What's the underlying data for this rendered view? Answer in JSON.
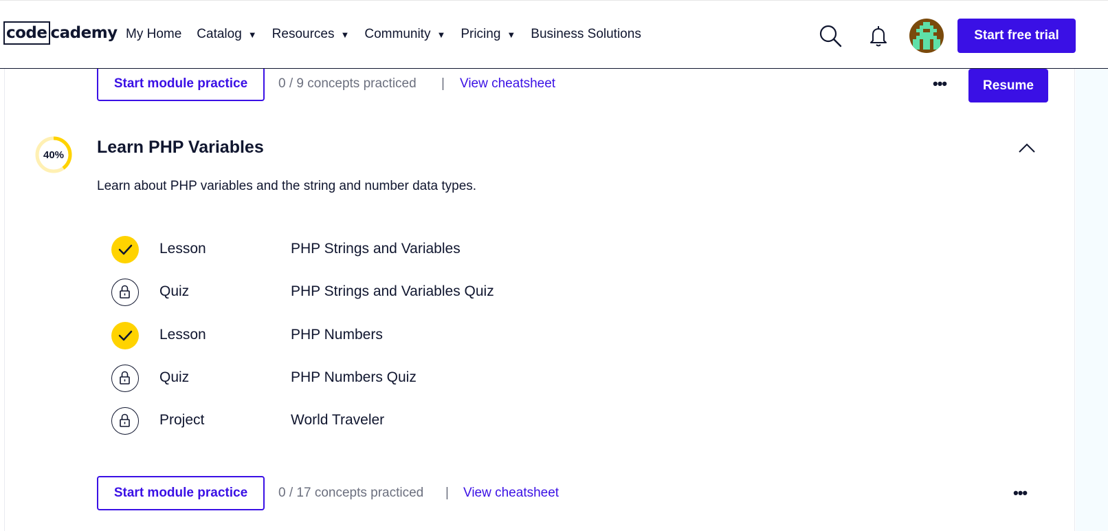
{
  "header": {
    "logo_box": "code",
    "logo_rest": "cademy",
    "nav": [
      {
        "label": "My Home",
        "caret": false
      },
      {
        "label": "Catalog",
        "caret": true
      },
      {
        "label": "Resources",
        "caret": true
      },
      {
        "label": "Community",
        "caret": true
      },
      {
        "label": "Pricing",
        "caret": true
      },
      {
        "label": "Business Solutions",
        "caret": false
      }
    ],
    "caret_glyph": "▼",
    "trial_label": "Start free trial"
  },
  "prev_module": {
    "practice_label": "Start module practice",
    "concepts": "0 / 9 concepts practiced",
    "separator": "|",
    "cheatsheet_label": "View cheatsheet",
    "more_label": "•••",
    "resume_label": "Resume"
  },
  "module": {
    "progress_label": "40%",
    "progress_value": 0.4,
    "title": "Learn PHP Variables",
    "description": "Learn about PHP variables and the string and number data types.",
    "items": [
      {
        "kind": "Lesson",
        "name": "PHP Strings and Variables",
        "status": "completed"
      },
      {
        "kind": "Quiz",
        "name": "PHP Strings and Variables Quiz",
        "status": "locked"
      },
      {
        "kind": "Lesson",
        "name": "PHP Numbers",
        "status": "completed"
      },
      {
        "kind": "Quiz",
        "name": "PHP Numbers Quiz",
        "status": "locked"
      },
      {
        "kind": "Project",
        "name": "World Traveler",
        "status": "locked"
      }
    ],
    "practice_label": "Start module practice",
    "concepts": "0 / 17 concepts practiced",
    "separator": "|",
    "cheatsheet_label": "View cheatsheet",
    "more_label": "•••"
  },
  "colors": {
    "brand": "#3a10e5",
    "navy": "#10162f",
    "progress_yellow": "#ffd300",
    "progress_track": "#fff0b3"
  }
}
